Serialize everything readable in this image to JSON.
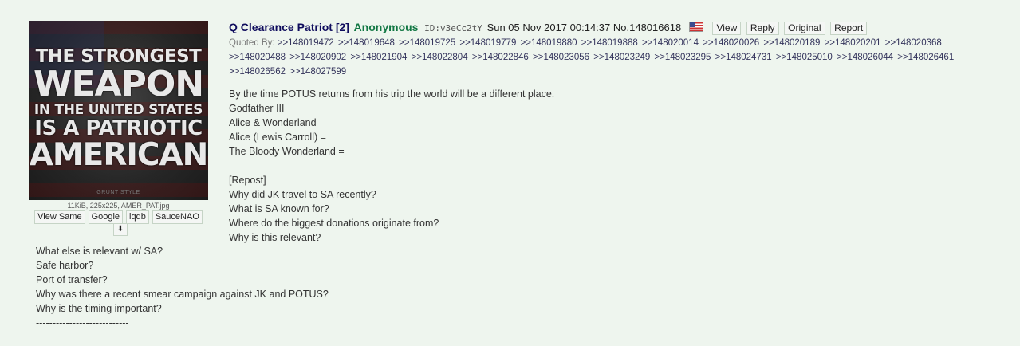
{
  "thumbnail": {
    "image_text": [
      "THE STRONGEST",
      "WEAPON",
      "IN THE UNITED STATES",
      "IS A PATRIOTIC",
      "AMERICAN"
    ],
    "mark": "GRUNT STYLE",
    "file_info": "11KiB, 225x225, AMER_PAT.jpg",
    "tools": [
      "View Same",
      "Google",
      "iqdb",
      "SauceNAO"
    ],
    "download_icon": "download-icon"
  },
  "post": {
    "subject": "Q Clearance Patriot [2]",
    "name": "Anonymous",
    "id": "ID:v3eCc2tY",
    "date": "Sun 05 Nov 2017 00:14:37",
    "number": "No.148016618",
    "flag": "us-flag-icon",
    "buttons": [
      "View",
      "Reply",
      "Original",
      "Report"
    ],
    "quoted_by_label": "Quoted By:",
    "quoted_by": [
      ">>148019472",
      ">>148019648",
      ">>148019725",
      ">>148019779",
      ">>148019880",
      ">>148019888",
      ">>148020014",
      ">>148020026",
      ">>148020189",
      ">>148020201",
      ">>148020368",
      ">>148020488",
      ">>148020902",
      ">>148021904",
      ">>148022804",
      ">>148022846",
      ">>148023056",
      ">>148023249",
      ">>148023295",
      ">>148024731",
      ">>148025010",
      ">>148026044",
      ">>148026461",
      ">>148026562",
      ">>148027599"
    ],
    "body_lines_side": [
      "By the time POTUS returns from his trip the world will be a different place.",
      "Godfather III",
      "Alice & Wonderland",
      "Alice (Lewis Carroll) =",
      "The Bloody Wonderland =",
      "",
      "[Repost]",
      "Why did JK travel to SA recently?",
      "What is SA known for?",
      "Where do the biggest donations originate from?",
      "Why is this relevant?"
    ],
    "body_lines_wrap": [
      "What else is relevant w/ SA?",
      "Safe harbor?",
      "Port of transfer?",
      "Why was there a recent smear campaign against JK and POTUS?",
      "Why is the timing important?",
      "----------------------------"
    ]
  },
  "colors": {
    "background": "#eef5ee",
    "subject": "#0f0c5d",
    "name": "#117743",
    "quote_link": "#34345c"
  }
}
